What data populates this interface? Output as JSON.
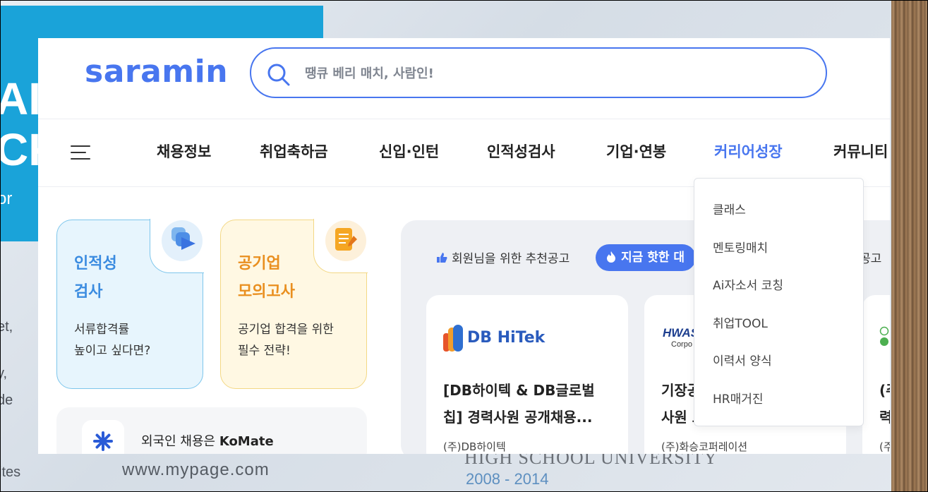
{
  "background": {
    "poster_lines": [
      "AI",
      "CK",
      "or"
    ],
    "side_lines": [
      "et,",
      "y,",
      "de"
    ],
    "url_text": "www.mypage.com",
    "ites": "ites",
    "school_text": "HIGH SCHOOL UNIVERSITY",
    "years": "2008 - 2014"
  },
  "header": {
    "logo": "saramin",
    "search_placeholder": "땡큐 베리 매치, 사람인!"
  },
  "gnb": {
    "items": [
      "채용정보",
      "취업축하금",
      "신입·인턴",
      "인적성검사",
      "기업·연봉",
      "커리어성장",
      "커뮤니티"
    ],
    "active": "커리어성장"
  },
  "dropdown": {
    "items": [
      "클래스",
      "멘토링매치",
      "Ai자소서 코칭",
      "취업TOOL",
      "이력서 양식",
      "HR매거진"
    ]
  },
  "promos": [
    {
      "title_line1": "인적성",
      "title_line2": "검사",
      "desc_line1": "서류합격률",
      "desc_line2": "높이고 싶다면?"
    },
    {
      "title_line1": "공기업",
      "title_line2": "모의고사",
      "desc_line1": "공기업 합격을 위한",
      "desc_line2": "필수 전략!"
    }
  ],
  "komate": {
    "prefix": "외국인 채용은 ",
    "brand": "KoMate"
  },
  "recommend": {
    "member_label": "회원님을 위한 추천공고",
    "hot_label": "지금 핫한 대",
    "third_label": "공고"
  },
  "jobs": [
    {
      "logo": "DB HiTek",
      "title_line1": "[DB하이텍 & DB글로벌",
      "title_line2": "칩] 경력사원 공개채용...",
      "company": "(주)DB하이텍"
    },
    {
      "logo": "HWAS",
      "logo_sub": "Corpo",
      "title_line1": "기장공",
      "title_line2": "사원 모집",
      "company": "(주)화승코퍼레이션"
    },
    {
      "logo": "",
      "title_line1": "(주",
      "title_line2": "력",
      "company": "(주"
    }
  ],
  "colors": {
    "brand": "#4876ef",
    "blue_accent": "#3a8be0",
    "orange_accent": "#e98f1f"
  }
}
